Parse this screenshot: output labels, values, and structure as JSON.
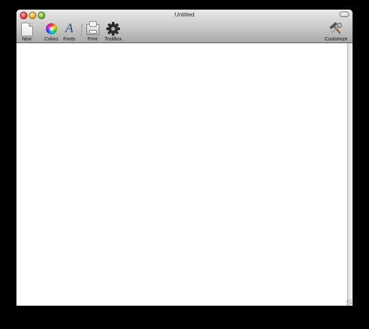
{
  "window": {
    "title": "Untitled"
  },
  "toolbar": {
    "items": [
      {
        "label": "New",
        "icon": "new-document-icon"
      },
      {
        "label": "Colors",
        "icon": "color-wheel-icon"
      },
      {
        "label": "Fonts",
        "icon": "font-icon",
        "glyph": "A"
      },
      {
        "label": "Print",
        "icon": "printer-icon"
      },
      {
        "label": "ToolBox",
        "icon": "gear-icon"
      },
      {
        "label": "Customize",
        "icon": "tools-icon"
      }
    ]
  },
  "document": {
    "text": ""
  }
}
